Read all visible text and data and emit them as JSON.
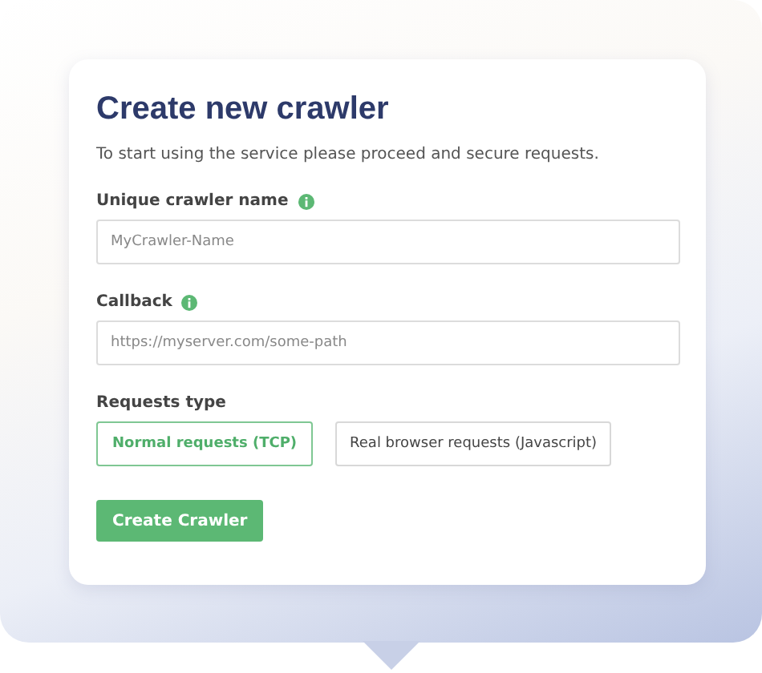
{
  "title": "Create new crawler",
  "subtitle": "To start using the service please proceed and secure requests.",
  "fields": [
    {
      "label": "Unique crawler name",
      "info": true,
      "placeholder": "MyCrawler-Name"
    },
    {
      "label": "Callback",
      "info": true,
      "placeholder": "https://myserver.com/some-path"
    }
  ],
  "requests_type": {
    "label": "Requests type",
    "options": [
      {
        "label": "Normal requests (TCP)",
        "selected": true
      },
      {
        "label": "Real browser requests (Javascript)",
        "selected": false
      }
    ]
  },
  "submit": {
    "label": "Create Crawler"
  }
}
